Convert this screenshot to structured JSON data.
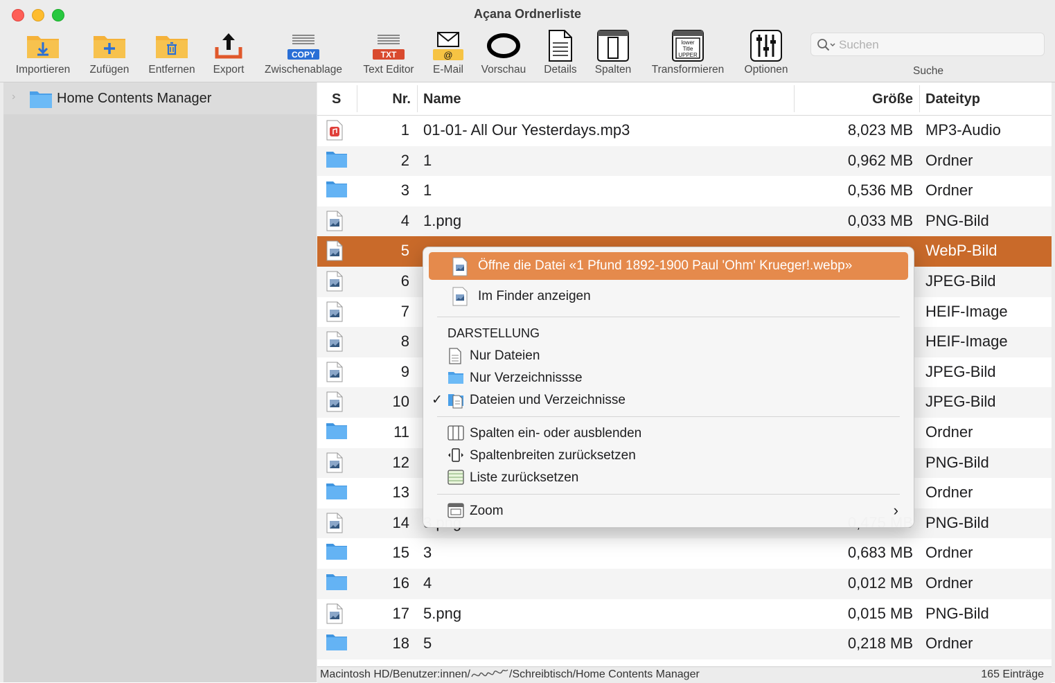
{
  "window": {
    "title": "Açana Ordnerliste"
  },
  "toolbar": {
    "importieren": "Importieren",
    "zufuegen": "Zufügen",
    "entfernen": "Entfernen",
    "export": "Export",
    "zwischenablage": "Zwischenablage",
    "copy_badge": "COPY",
    "text_editor": "Text Editor",
    "txt_badge": "TXT",
    "email": "E-Mail",
    "vorschau": "Vorschau",
    "details": "Details",
    "spalten": "Spalten",
    "transformieren": "Transformieren",
    "transform_lines": [
      "lower",
      "Title",
      "UPPER"
    ],
    "optionen": "Optionen",
    "search_placeholder": "Suchen",
    "search_label": "Suche"
  },
  "sidebar": {
    "root": "Home Contents Manager"
  },
  "table": {
    "headers": {
      "s": "S",
      "nr": "Nr.",
      "name": "Name",
      "size": "Größe",
      "type": "Dateityp"
    },
    "rows": [
      {
        "nr": "1",
        "name": "01-01- All Our Yesterdays.mp3",
        "size": "8,023 MB",
        "type": "MP3-Audio",
        "icon": "audio-file-icon"
      },
      {
        "nr": "2",
        "name": "1",
        "size": "0,962 MB",
        "type": "Ordner",
        "icon": "folder-icon"
      },
      {
        "nr": "3",
        "name": "1",
        "size": "0,536 MB",
        "type": "Ordner",
        "icon": "folder-icon"
      },
      {
        "nr": "4",
        "name": "1.png",
        "size": "0,033 MB",
        "type": "PNG-Bild",
        "icon": "image-file-icon"
      },
      {
        "nr": "5",
        "name": "",
        "size": "",
        "type": "WebP-Bild",
        "icon": "image-file-icon"
      },
      {
        "nr": "6",
        "name": "",
        "size": "",
        "type": "JPEG-Bild",
        "icon": "image-file-icon"
      },
      {
        "nr": "7",
        "name": "",
        "size": "",
        "type": "HEIF-Image",
        "icon": "image-file-icon"
      },
      {
        "nr": "8",
        "name": "",
        "size": "",
        "type": "HEIF-Image",
        "icon": "image-file-icon"
      },
      {
        "nr": "9",
        "name": "",
        "size": "",
        "type": "JPEG-Bild",
        "icon": "image-file-icon"
      },
      {
        "nr": "10",
        "name": "",
        "size": "",
        "type": "JPEG-Bild",
        "icon": "image-file-icon"
      },
      {
        "nr": "11",
        "name": "",
        "size": "",
        "type": "Ordner",
        "icon": "folder-icon"
      },
      {
        "nr": "12",
        "name": "",
        "size": "",
        "type": "PNG-Bild",
        "icon": "image-file-icon"
      },
      {
        "nr": "13",
        "name": "",
        "size": "",
        "type": "Ordner",
        "icon": "folder-icon"
      },
      {
        "nr": "14",
        "name": "3.png",
        "size": "0,475 MB",
        "type": "PNG-Bild",
        "icon": "image-file-icon"
      },
      {
        "nr": "15",
        "name": "3",
        "size": "0,683 MB",
        "type": "Ordner",
        "icon": "folder-icon"
      },
      {
        "nr": "16",
        "name": "4",
        "size": "0,012 MB",
        "type": "Ordner",
        "icon": "folder-icon"
      },
      {
        "nr": "17",
        "name": "5.png",
        "size": "0,015 MB",
        "type": "PNG-Bild",
        "icon": "image-file-icon"
      },
      {
        "nr": "18",
        "name": "5",
        "size": "0,218 MB",
        "type": "Ordner",
        "icon": "folder-icon"
      }
    ],
    "selected_row": "5"
  },
  "context_menu": {
    "open_file": "Öffne die Datei «1 Pfund 1892-1900 Paul 'Ohm' Krueger!.webp»",
    "show_in_finder": "Im Finder anzeigen",
    "section_header": "DARSTELLUNG",
    "only_files": "Nur Dateien",
    "only_dirs": "Nur Verzeichnissse",
    "files_and_dirs": "Dateien und Verzeichnisse",
    "checkmark": "✓",
    "toggle_columns": "Spalten ein- oder ausblenden",
    "reset_col_widths": "Spaltenbreiten zurücksetzen",
    "reset_list": "Liste zurücksetzen",
    "zoom": "Zoom"
  },
  "status": {
    "path_prefix": "Macintosh HD/Benutzer:innen/",
    "path_suffix": "/Schreibtisch/Home Contents Manager",
    "count": "165 Einträge"
  },
  "colors": {
    "selection": "#c96a2a",
    "menu_highlight": "#e58a4c",
    "folder": "#5aaef0"
  }
}
